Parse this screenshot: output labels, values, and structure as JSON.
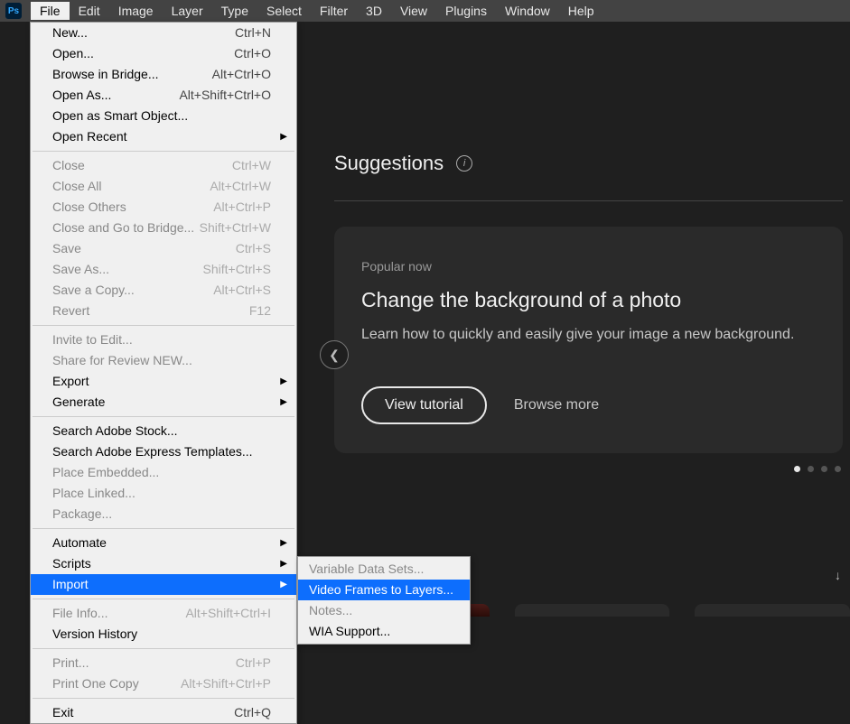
{
  "menubar": {
    "items": [
      "File",
      "Edit",
      "Image",
      "Layer",
      "Type",
      "Select",
      "Filter",
      "3D",
      "View",
      "Plugins",
      "Window",
      "Help"
    ],
    "open_index": 0
  },
  "file_menu": {
    "sections": [
      [
        {
          "label": "New...",
          "shortcut": "Ctrl+N"
        },
        {
          "label": "Open...",
          "shortcut": "Ctrl+O"
        },
        {
          "label": "Browse in Bridge...",
          "shortcut": "Alt+Ctrl+O"
        },
        {
          "label": "Open As...",
          "shortcut": "Alt+Shift+Ctrl+O"
        },
        {
          "label": "Open as Smart Object..."
        },
        {
          "label": "Open Recent",
          "submenu": true
        }
      ],
      [
        {
          "label": "Close",
          "shortcut": "Ctrl+W",
          "disabled": true
        },
        {
          "label": "Close All",
          "shortcut": "Alt+Ctrl+W",
          "disabled": true
        },
        {
          "label": "Close Others",
          "shortcut": "Alt+Ctrl+P",
          "disabled": true
        },
        {
          "label": "Close and Go to Bridge...",
          "shortcut": "Shift+Ctrl+W",
          "disabled": true
        },
        {
          "label": "Save",
          "shortcut": "Ctrl+S",
          "disabled": true
        },
        {
          "label": "Save As...",
          "shortcut": "Shift+Ctrl+S",
          "disabled": true
        },
        {
          "label": "Save a Copy...",
          "shortcut": "Alt+Ctrl+S",
          "disabled": true
        },
        {
          "label": "Revert",
          "shortcut": "F12",
          "disabled": true
        }
      ],
      [
        {
          "label": "Invite to Edit...",
          "disabled": true
        },
        {
          "label": "Share for Review NEW...",
          "disabled": true
        },
        {
          "label": "Export",
          "submenu": true
        },
        {
          "label": "Generate",
          "submenu": true
        }
      ],
      [
        {
          "label": "Search Adobe Stock..."
        },
        {
          "label": "Search Adobe Express Templates..."
        },
        {
          "label": "Place Embedded...",
          "disabled": true
        },
        {
          "label": "Place Linked...",
          "disabled": true
        },
        {
          "label": "Package...",
          "disabled": true
        }
      ],
      [
        {
          "label": "Automate",
          "submenu": true
        },
        {
          "label": "Scripts",
          "submenu": true
        },
        {
          "label": "Import",
          "submenu": true,
          "highlighted": true
        }
      ],
      [
        {
          "label": "File Info...",
          "shortcut": "Alt+Shift+Ctrl+I",
          "disabled": true
        },
        {
          "label": "Version History"
        }
      ],
      [
        {
          "label": "Print...",
          "shortcut": "Ctrl+P",
          "disabled": true
        },
        {
          "label": "Print One Copy",
          "shortcut": "Alt+Shift+Ctrl+P",
          "disabled": true
        }
      ],
      [
        {
          "label": "Exit",
          "shortcut": "Ctrl+Q"
        }
      ]
    ]
  },
  "import_submenu": {
    "items": [
      {
        "label": "Variable Data Sets...",
        "disabled": true
      },
      {
        "label": "Video Frames to Layers...",
        "highlighted": true
      },
      {
        "label": "Notes...",
        "disabled": true
      },
      {
        "label": "WIA Support..."
      }
    ]
  },
  "suggestions": {
    "title": "Suggestions",
    "card": {
      "tag": "Popular now",
      "title": "Change the background of a photo",
      "desc": "Learn how to quickly and easily give your image a new background.",
      "view_tutorial": "View tutorial",
      "browse_more": "Browse more"
    }
  }
}
